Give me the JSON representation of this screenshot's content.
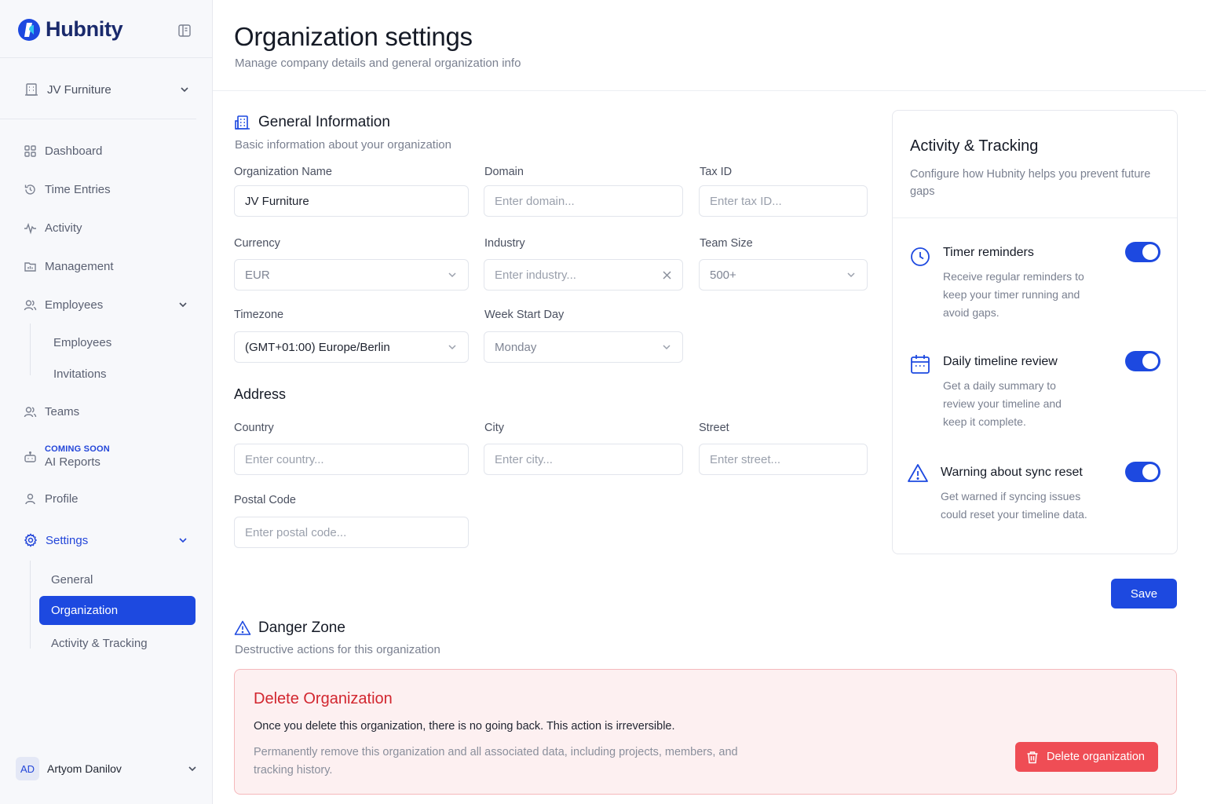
{
  "app": {
    "brand": "Hubnity"
  },
  "sidebar": {
    "org_name": "JV Furniture",
    "nav": {
      "dashboard": "Dashboard",
      "time_entries": "Time Entries",
      "activity": "Activity",
      "management": "Management",
      "employees": "Employees",
      "teams": "Teams",
      "ai_reports_badge": "COMING SOON",
      "ai_reports": "AI Reports",
      "profile": "Profile",
      "settings": "Settings"
    },
    "employees_sub": [
      "Employees",
      "Invitations"
    ],
    "settings_sub": [
      "General",
      "Organization",
      "Activity & Tracking"
    ],
    "user": {
      "initials": "AD",
      "name": "Artyom Danilov"
    }
  },
  "header": {
    "title": "Organization settings",
    "subtitle": "Manage company details and general organization info"
  },
  "general": {
    "title": "General Information",
    "subtitle": "Basic information about your organization",
    "fields": {
      "org_name": {
        "label": "Organization Name",
        "value": "JV Furniture"
      },
      "domain": {
        "label": "Domain",
        "placeholder": "Enter domain..."
      },
      "tax_id": {
        "label": "Tax ID",
        "placeholder": "Enter tax ID..."
      },
      "currency": {
        "label": "Currency",
        "value": "EUR"
      },
      "industry": {
        "label": "Industry",
        "placeholder": "Enter industry..."
      },
      "team_size": {
        "label": "Team Size",
        "value": "500+"
      },
      "timezone": {
        "label": "Timezone",
        "value": "(GMT+01:00) Europe/Berlin"
      },
      "week_start": {
        "label": "Week Start Day",
        "value": "Monday"
      }
    }
  },
  "address": {
    "title": "Address",
    "fields": {
      "country": {
        "label": "Country",
        "placeholder": "Enter country..."
      },
      "city": {
        "label": "City",
        "placeholder": "Enter city..."
      },
      "street": {
        "label": "Street",
        "placeholder": "Enter street..."
      },
      "postal": {
        "label": "Postal Code",
        "placeholder": "Enter postal code..."
      }
    }
  },
  "activity": {
    "title": "Activity & Tracking",
    "description": "Configure how Hubnity helps you prevent future gaps",
    "settings": [
      {
        "title": "Timer reminders",
        "description": "Receive regular reminders to keep your timer running and avoid gaps.",
        "enabled": true
      },
      {
        "title": "Daily timeline review",
        "description": "Get a daily summary to review your timeline and keep it complete.",
        "enabled": true
      },
      {
        "title": "Warning about sync reset",
        "description": "Get warned if syncing issues could reset your timeline data.",
        "enabled": true
      }
    ]
  },
  "actions": {
    "save": "Save"
  },
  "danger": {
    "title": "Danger Zone",
    "subtitle": "Destructive actions for this organization",
    "box_title": "Delete Organization",
    "warning": "Once you delete this organization, there is no going back. This action is irreversible.",
    "description": "Permanently remove this organization and all associated data, including projects, members, and tracking history.",
    "button": "Delete organization"
  },
  "colors": {
    "primary": "#1d49e0",
    "danger": "#ef4d55",
    "danger_text": "#d2262f"
  }
}
